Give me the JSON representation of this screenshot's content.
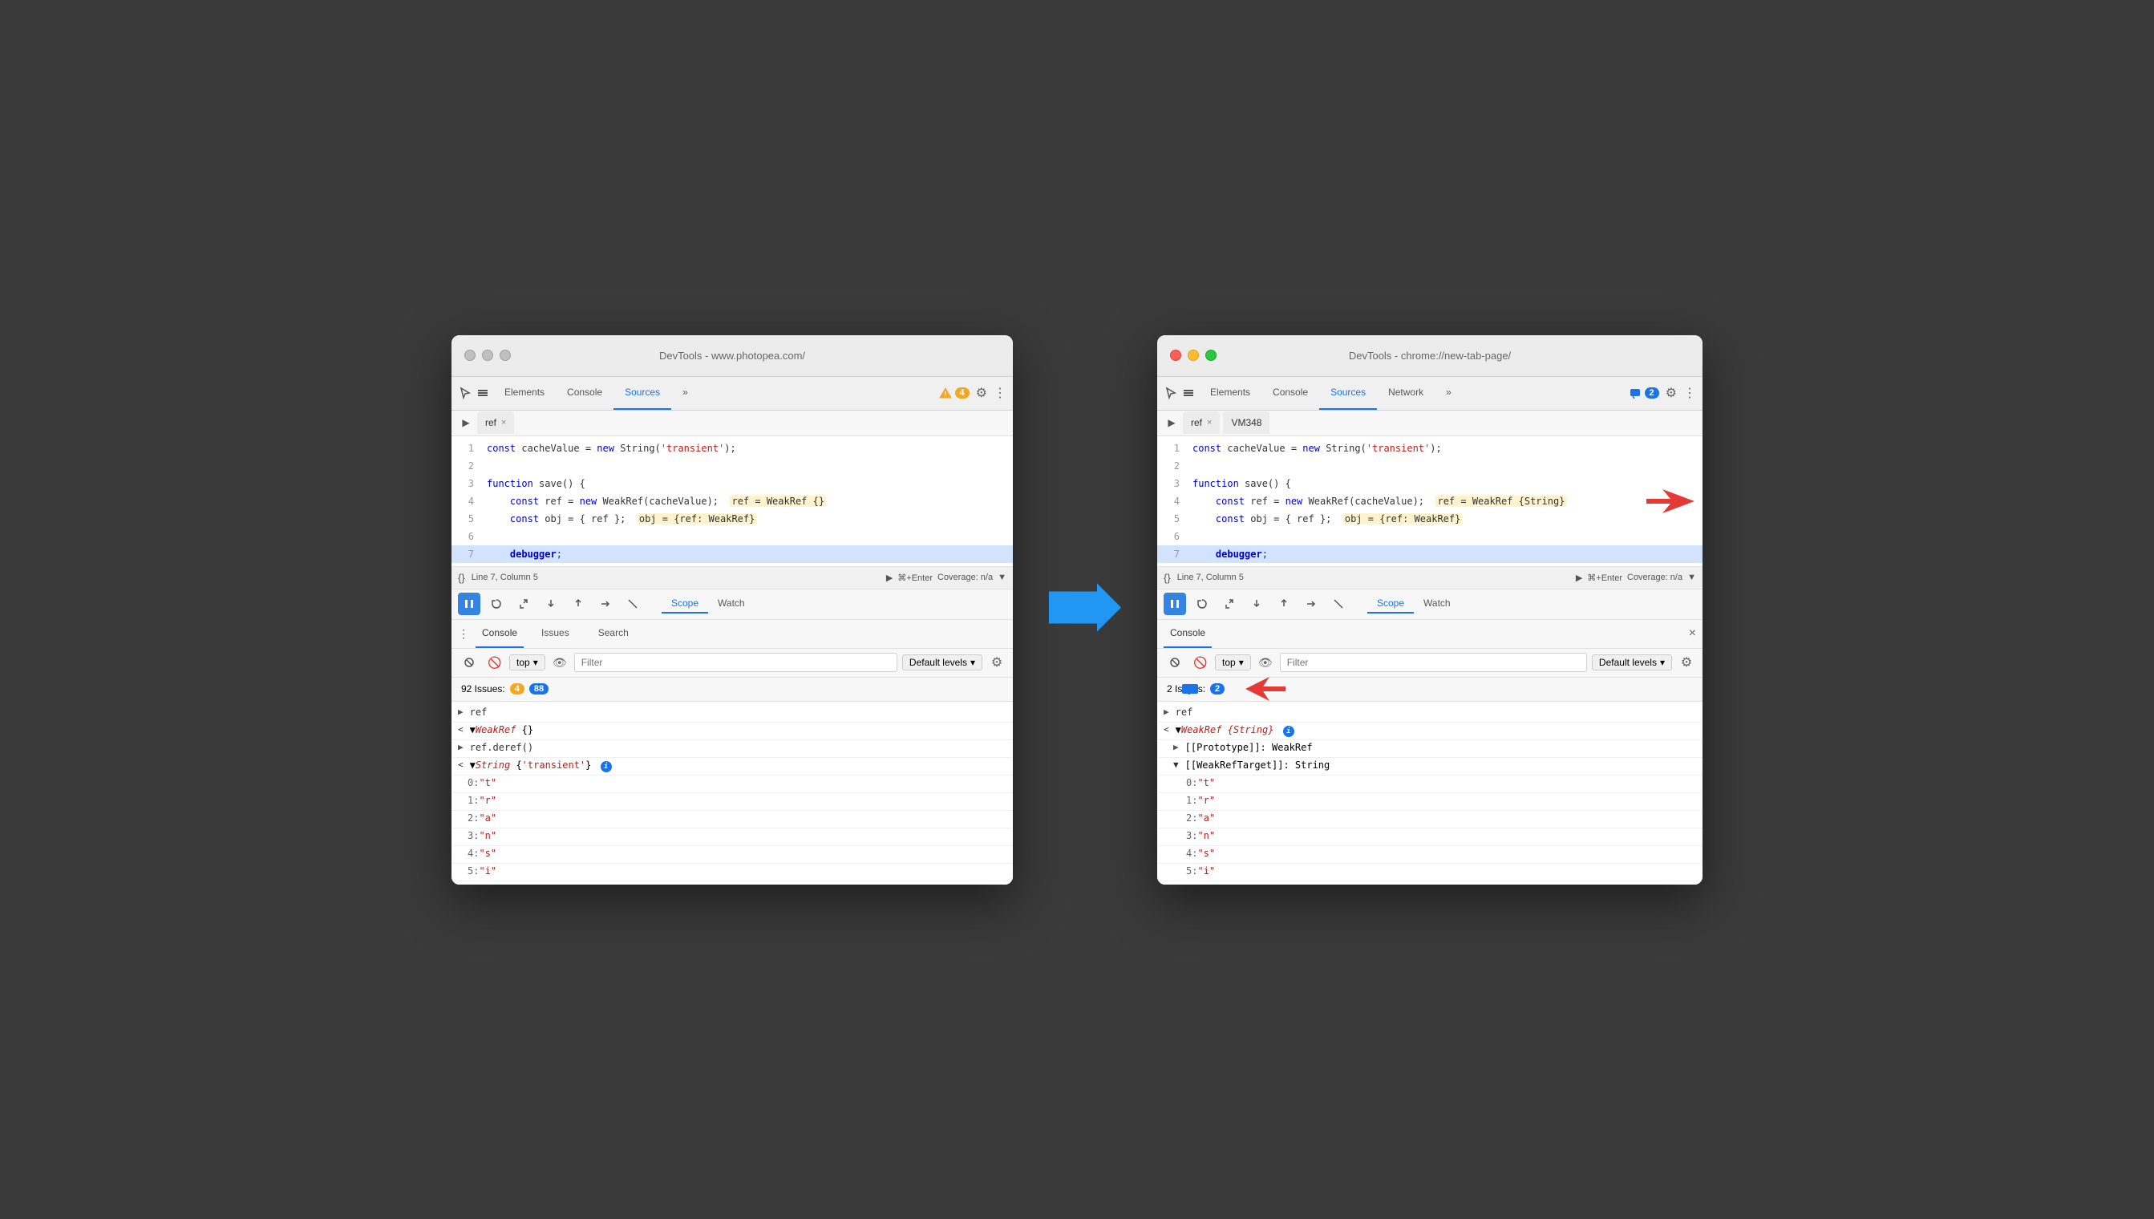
{
  "left_window": {
    "title": "DevTools - www.photopea.com/",
    "tabs": [
      "Elements",
      "Console",
      "Sources",
      "»"
    ],
    "active_tab": "Sources",
    "badge": "4",
    "file_tabs": [
      "ref"
    ],
    "code_lines": [
      {
        "num": 1,
        "content": "const cacheValue = new String('transient');"
      },
      {
        "num": 2,
        "content": ""
      },
      {
        "num": 3,
        "content": "function save() {"
      },
      {
        "num": 4,
        "content": "    const ref = new WeakRef(cacheValue);  ref = WeakRef {}"
      },
      {
        "num": 5,
        "content": "    const obj = { ref };  obj = {ref: WeakRef}"
      },
      {
        "num": 6,
        "content": ""
      },
      {
        "num": 7,
        "content": "    debugger;",
        "highlighted": true
      }
    ],
    "status": "Line 7, Column 5",
    "coverage": "Coverage: n/a",
    "scope_tabs": [
      "Scope",
      "Watch"
    ],
    "active_scope": "Scope",
    "console_tabs": [
      "Console",
      "Issues",
      "Search"
    ],
    "active_console": "Console",
    "filter_placeholder": "Filter",
    "levels": "Default levels",
    "issues_count": "92 Issues:",
    "issues_warn": "4",
    "issues_info": "88",
    "console_rows": [
      {
        "type": "collapsed",
        "indent": 0,
        "content": "ref"
      },
      {
        "type": "expanded",
        "indent": 0,
        "content": "▼WeakRef {}"
      },
      {
        "type": "item",
        "indent": 0,
        "content": "ref.deref()"
      },
      {
        "type": "expanded",
        "indent": 0,
        "content": "▼String {'transient'}"
      },
      {
        "type": "item",
        "indent": 1,
        "content": "0: \"t\""
      },
      {
        "type": "item",
        "indent": 1,
        "content": "1: \"r\""
      },
      {
        "type": "item",
        "indent": 1,
        "content": "2: \"a\""
      },
      {
        "type": "item",
        "indent": 1,
        "content": "3: \"n\""
      },
      {
        "type": "item",
        "indent": 1,
        "content": "4: \"s\""
      },
      {
        "type": "item",
        "indent": 1,
        "content": "5: \"i\""
      }
    ]
  },
  "right_window": {
    "title": "DevTools - chrome://new-tab-page/",
    "tabs": [
      "Elements",
      "Console",
      "Sources",
      "Network",
      "»"
    ],
    "active_tab": "Sources",
    "badge": "2",
    "file_tabs": [
      "ref",
      "VM348"
    ],
    "code_lines": [
      {
        "num": 1,
        "content": "const cacheValue = new String('transient');"
      },
      {
        "num": 2,
        "content": ""
      },
      {
        "num": 3,
        "content": "function save() {"
      },
      {
        "num": 4,
        "content": "    const ref = new WeakRef(cacheValue);  ref = WeakRef {String}"
      },
      {
        "num": 5,
        "content": "    const obj = { ref };  obj = {ref: WeakRef}"
      },
      {
        "num": 6,
        "content": ""
      },
      {
        "num": 7,
        "content": "    debugger;",
        "highlighted": true
      }
    ],
    "status": "Line 7, Column 5",
    "coverage": "Coverage: n/a",
    "scope_tabs": [
      "Scope",
      "Watch"
    ],
    "active_scope": "Scope",
    "console_title": "Console",
    "filter_placeholder": "Filter",
    "levels": "Default levels",
    "issues_count": "2 Issues:",
    "issues_info": "2",
    "console_rows": [
      {
        "type": "collapsed",
        "indent": 0,
        "content": "ref"
      },
      {
        "type": "expanded",
        "indent": 0,
        "content": "▼WeakRef {String}"
      },
      {
        "type": "item",
        "indent": 1,
        "content": "▶[[Prototype]]: WeakRef"
      },
      {
        "type": "item",
        "indent": 1,
        "content": "▼[[WeakRefTarget]]: String"
      },
      {
        "type": "item",
        "indent": 2,
        "content": "0: \"t\""
      },
      {
        "type": "item",
        "indent": 2,
        "content": "1: \"r\""
      },
      {
        "type": "item",
        "indent": 2,
        "content": "2: \"a\""
      },
      {
        "type": "item",
        "indent": 2,
        "content": "3: \"n\""
      },
      {
        "type": "item",
        "indent": 2,
        "content": "4: \"s\""
      },
      {
        "type": "item",
        "indent": 2,
        "content": "5: \"i\""
      }
    ]
  },
  "ui": {
    "close_label": "×",
    "top_label": "top",
    "scope_label": "Scope",
    "watch_label": "Watch"
  }
}
